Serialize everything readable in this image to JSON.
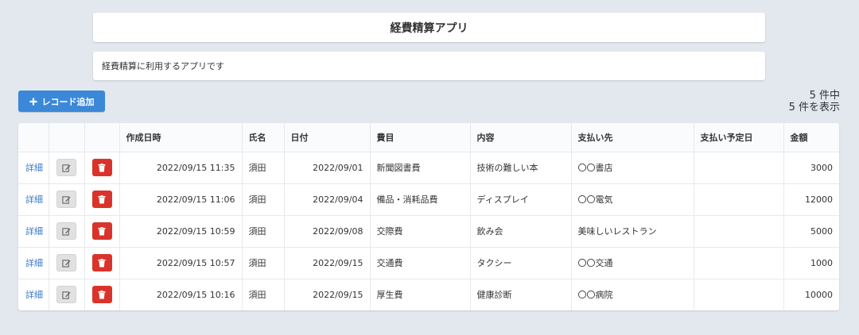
{
  "header": {
    "title": "経費精算アプリ"
  },
  "description": "経費精算に利用するアプリです",
  "toolbar": {
    "add_label": "レコード追加",
    "count_line1": "5 件中",
    "count_line2": "5 件を表示"
  },
  "colors": {
    "primary": "#3b88d8",
    "danger": "#d9342b",
    "link": "#3b79c4",
    "background": "#e3e8ef"
  },
  "table": {
    "columns": [
      "",
      "",
      "",
      "作成日時",
      "氏名",
      "日付",
      "費目",
      "内容",
      "支払い先",
      "支払い予定日",
      "金額"
    ],
    "detail_label": "詳細",
    "rows": [
      {
        "created": "2022/09/15 11:35",
        "name": "須田",
        "date": "2022/09/01",
        "category": "新聞図書費",
        "content": "技術の難しい本",
        "payee": "〇〇書店",
        "due": "",
        "amount": "3000"
      },
      {
        "created": "2022/09/15 11:06",
        "name": "須田",
        "date": "2022/09/04",
        "category": "備品・消耗品費",
        "content": "ディスプレイ",
        "payee": "〇〇電気",
        "due": "",
        "amount": "12000"
      },
      {
        "created": "2022/09/15 10:59",
        "name": "須田",
        "date": "2022/09/08",
        "category": "交際費",
        "content": "飲み会",
        "payee": "美味しいレストラン",
        "due": "",
        "amount": "5000"
      },
      {
        "created": "2022/09/15 10:57",
        "name": "須田",
        "date": "2022/09/15",
        "category": "交通費",
        "content": "タクシー",
        "payee": "〇〇交通",
        "due": "",
        "amount": "1000"
      },
      {
        "created": "2022/09/15 10:16",
        "name": "須田",
        "date": "2022/09/15",
        "category": "厚生費",
        "content": "健康診断",
        "payee": "〇〇病院",
        "due": "",
        "amount": "10000"
      }
    ]
  }
}
